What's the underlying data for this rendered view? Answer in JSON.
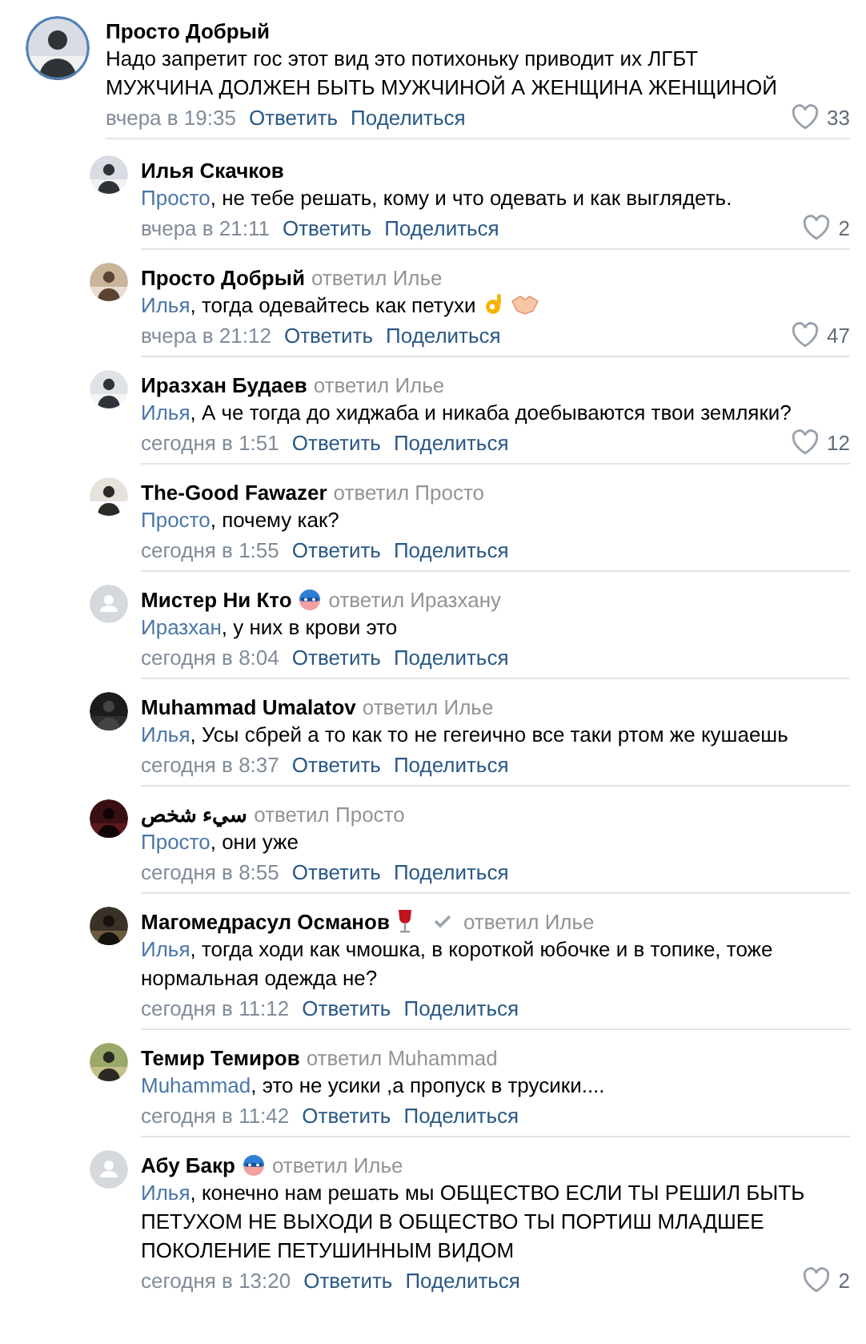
{
  "comment": {
    "author": "Просто Добрый",
    "text": "Надо запретит гос этот вид это потихоньку приводит их ЛГБТ\nМУЖЧИНА ДОЛЖЕН БЫТЬ МУЖЧИНОЙ А ЖЕНЩИНА ЖЕНЩИНОЙ",
    "time": "вчера в 19:35",
    "reply_label": "Ответить",
    "share_label": "Поделиться",
    "likes": "33",
    "liked": false
  },
  "replies": [
    {
      "author": "Илья Скачков",
      "mention": "Просто",
      "text": ", не тебе решать, кому и что одевать и как выглядеть.",
      "time": "вчера в 21:11",
      "reply_label": "Ответить",
      "share_label": "Поделиться",
      "likes": "2",
      "liked": false
    },
    {
      "author": "Просто Добрый",
      "reply_to": "ответил Илье",
      "mention": "Илья",
      "text": ", тогда одевайтесь как петухи",
      "emojis": [
        {
          "kind": "ok-hand"
        },
        {
          "kind": "handshake"
        }
      ],
      "time": "вчера в 21:12",
      "reply_label": "Ответить",
      "share_label": "Поделиться",
      "likes": "47",
      "liked": false
    },
    {
      "author": "Иразхан Будаев",
      "reply_to": "ответил Илье",
      "mention": "Илья",
      "text": ", А че тогда до хиджаба и никаба доебываются твои земляки?",
      "time": "сегодня в 1:51",
      "reply_label": "Ответить",
      "share_label": "Поделиться",
      "likes": "12",
      "liked": false
    },
    {
      "author": "The-Good Fawazer",
      "reply_to": "ответил Просто",
      "mention": "Просто",
      "text": ", почему как?",
      "time": "сегодня в 1:55",
      "reply_label": "Ответить",
      "share_label": "Поделиться"
    },
    {
      "author": "Мистер Ни Кто",
      "avatar": {
        "kind": "placeholder"
      },
      "badge": {
        "kind": "mask"
      },
      "reply_to": "ответил Иразхану",
      "mention": "Иразхан",
      "text": ", у них в крови это",
      "time": "сегодня в 8:04",
      "reply_label": "Ответить",
      "share_label": "Поделиться"
    },
    {
      "author": "Muhammad Umalatov",
      "reply_to": "ответил Илье",
      "mention": "Илья",
      "text": ", Усы сбрей а то как то не гегеично все таки ртом же кушаешь",
      "time": "сегодня в 8:37",
      "reply_label": "Ответить",
      "share_label": "Поделиться"
    },
    {
      "author": "سيء شخص",
      "reply_to": "ответил Просто",
      "mention": "Просто",
      "text": ", они уже",
      "time": "сегодня в 8:55",
      "reply_label": "Ответить",
      "share_label": "Поделиться"
    },
    {
      "author": "Магомедрасул Османов",
      "badge": {
        "kind": "wine"
      },
      "verified": true,
      "reply_to": "ответил Илье",
      "mention": "Илья",
      "text": ", тогда ходи как чмошка, в короткой юбочке и в топике, тоже нормальная одежда не?",
      "time": "сегодня в 11:12",
      "reply_label": "Ответить",
      "share_label": "Поделиться"
    },
    {
      "author": "Темир Темиров",
      "reply_to": "ответил Muhammad",
      "mention": "Muhammad",
      "text": ", это не усики ,а пропуск в трусики....",
      "time": "сегодня в 11:42",
      "reply_label": "Ответить",
      "share_label": "Поделиться"
    },
    {
      "author": "Абу Бакр",
      "avatar": {
        "kind": "placeholder"
      },
      "badge": {
        "kind": "mask"
      },
      "reply_to": "ответил Илье",
      "mention": "Илья",
      "text": ", конечно нам решать мы ОБЩЕСТВО ЕСЛИ ТЫ РЕШИЛ БЫТЬ ПЕТУХОМ НЕ ВЫХОДИ В ОБЩЕСТВО ТЫ ПОРТИШ МЛАДШЕЕ ПОКОЛЕНИЕ ПЕТУШИННЫМ ВИДОМ",
      "time": "сегодня в 13:20",
      "reply_label": "Ответить",
      "share_label": "Поделиться",
      "likes": "2",
      "liked": false
    }
  ]
}
